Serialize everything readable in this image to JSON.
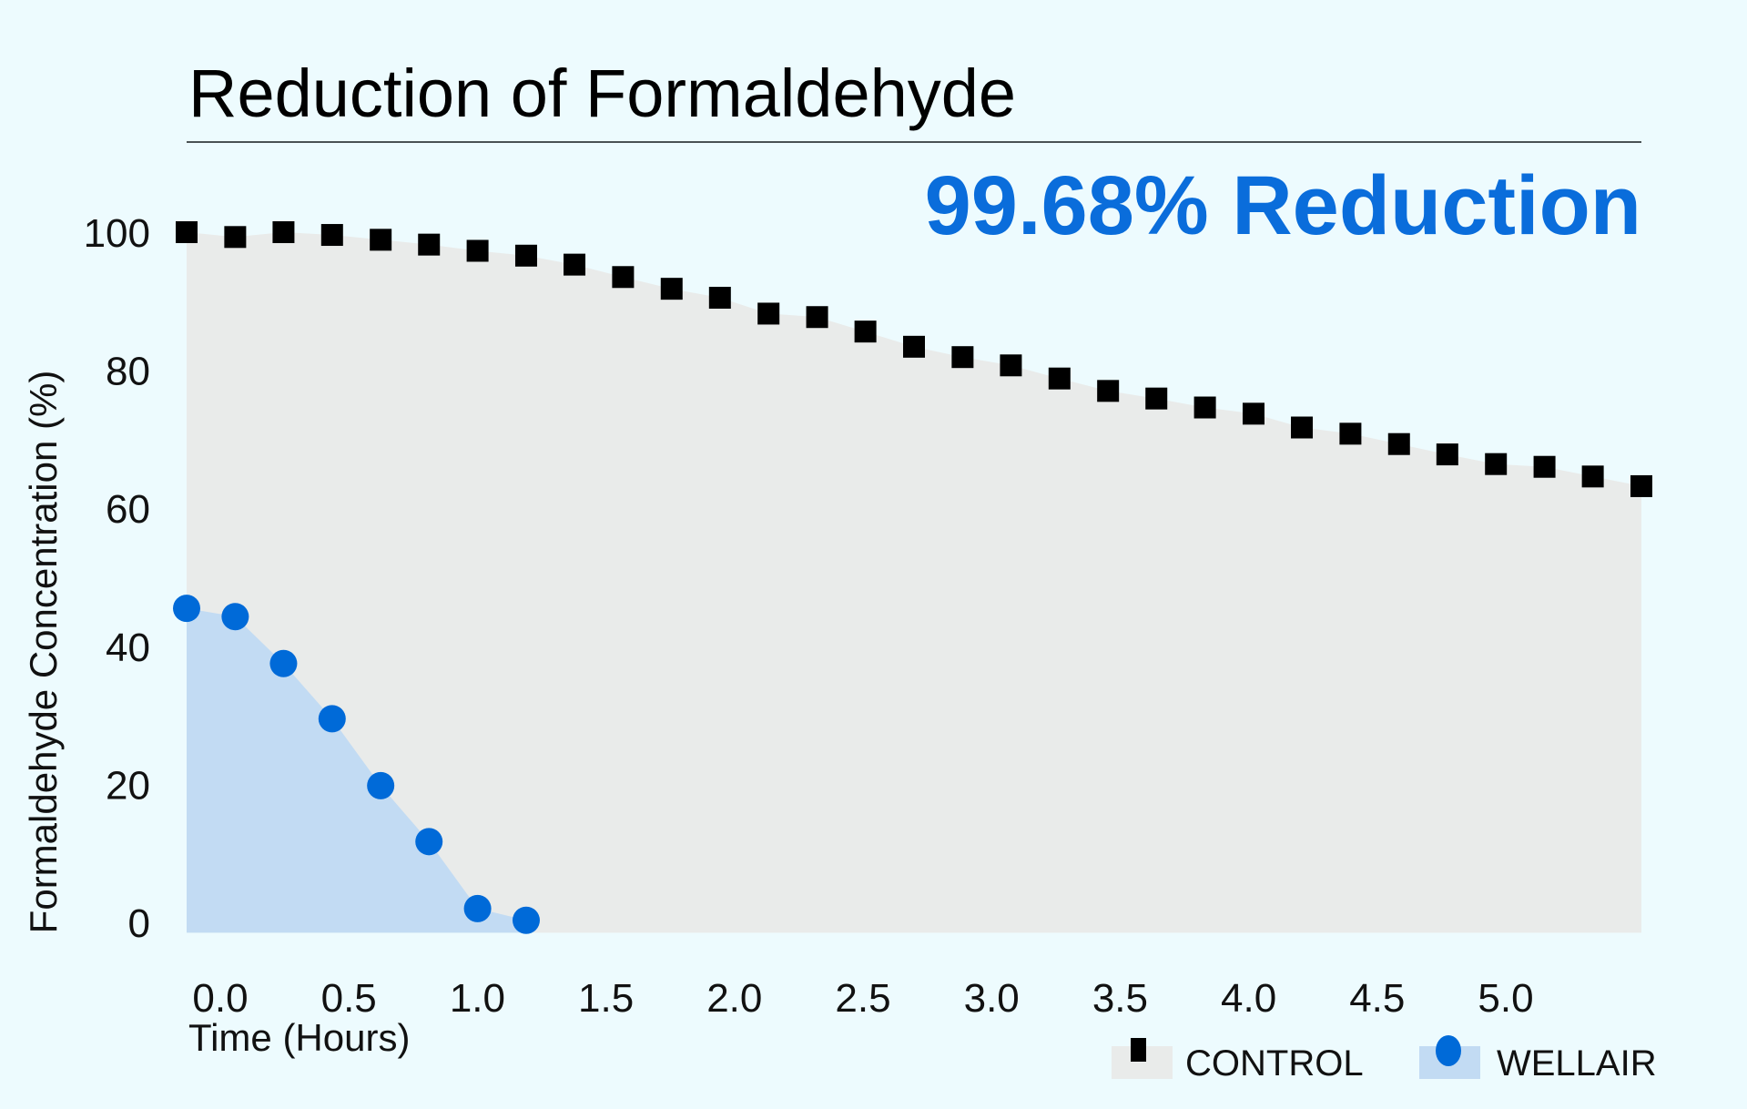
{
  "chart_data": {
    "type": "area",
    "title": "Reduction of Formaldehyde",
    "annotation": "99.68% Reduction",
    "xlabel": "Time (Hours)",
    "ylabel": "Formaldehyde Concentration (%)",
    "x_tick_labels": [
      "0.0",
      "0.5",
      "1.0",
      "1.5",
      "2.0",
      "2.5",
      "3.0",
      "3.5",
      "4.0",
      "4.5",
      "5.0"
    ],
    "x_ticks": [
      0.0,
      0.5,
      1.0,
      1.5,
      2.0,
      2.5,
      3.0,
      3.5,
      4.0,
      4.5,
      5.0
    ],
    "y_tick_labels": [
      "100",
      "80",
      "60",
      "40",
      "20",
      "0"
    ],
    "y_ticks": [
      100,
      80,
      60,
      40,
      20,
      0
    ],
    "xlim": [
      0,
      5.0
    ],
    "ylim": [
      -1.5,
      100
    ],
    "grid": false,
    "legend_position": "bottom-right",
    "x": [
      0.0,
      0.167,
      0.333,
      0.5,
      0.667,
      0.833,
      1.0,
      1.167,
      1.333,
      1.5,
      1.667,
      1.833,
      2.0,
      2.167,
      2.333,
      2.5,
      2.667,
      2.833,
      3.0,
      3.167,
      3.333,
      3.5,
      3.667,
      3.833,
      4.0,
      4.167,
      4.333,
      4.5,
      4.667,
      4.833,
      5.0
    ],
    "series": [
      {
        "name": "CONTROL",
        "marker": "square",
        "marker_color": "#000000",
        "fill_color": "#e9ebea",
        "values": [
          100.0,
          99.3,
          100.0,
          99.6,
          98.9,
          98.2,
          97.3,
          96.6,
          95.3,
          93.5,
          91.8,
          90.5,
          88.2,
          87.7,
          85.6,
          83.4,
          81.9,
          80.7,
          78.8,
          77.0,
          75.9,
          74.6,
          73.7,
          71.7,
          70.8,
          69.3,
          67.8,
          66.4,
          66.0,
          64.6,
          63.2
        ]
      },
      {
        "name": "WELLAIR",
        "marker": "circle",
        "marker_color": "#006ad8",
        "fill_color": "#c2dbf3",
        "values": [
          45.5,
          44.3,
          37.5,
          29.5,
          19.8,
          11.7,
          2.0,
          0.3
        ]
      }
    ]
  }
}
